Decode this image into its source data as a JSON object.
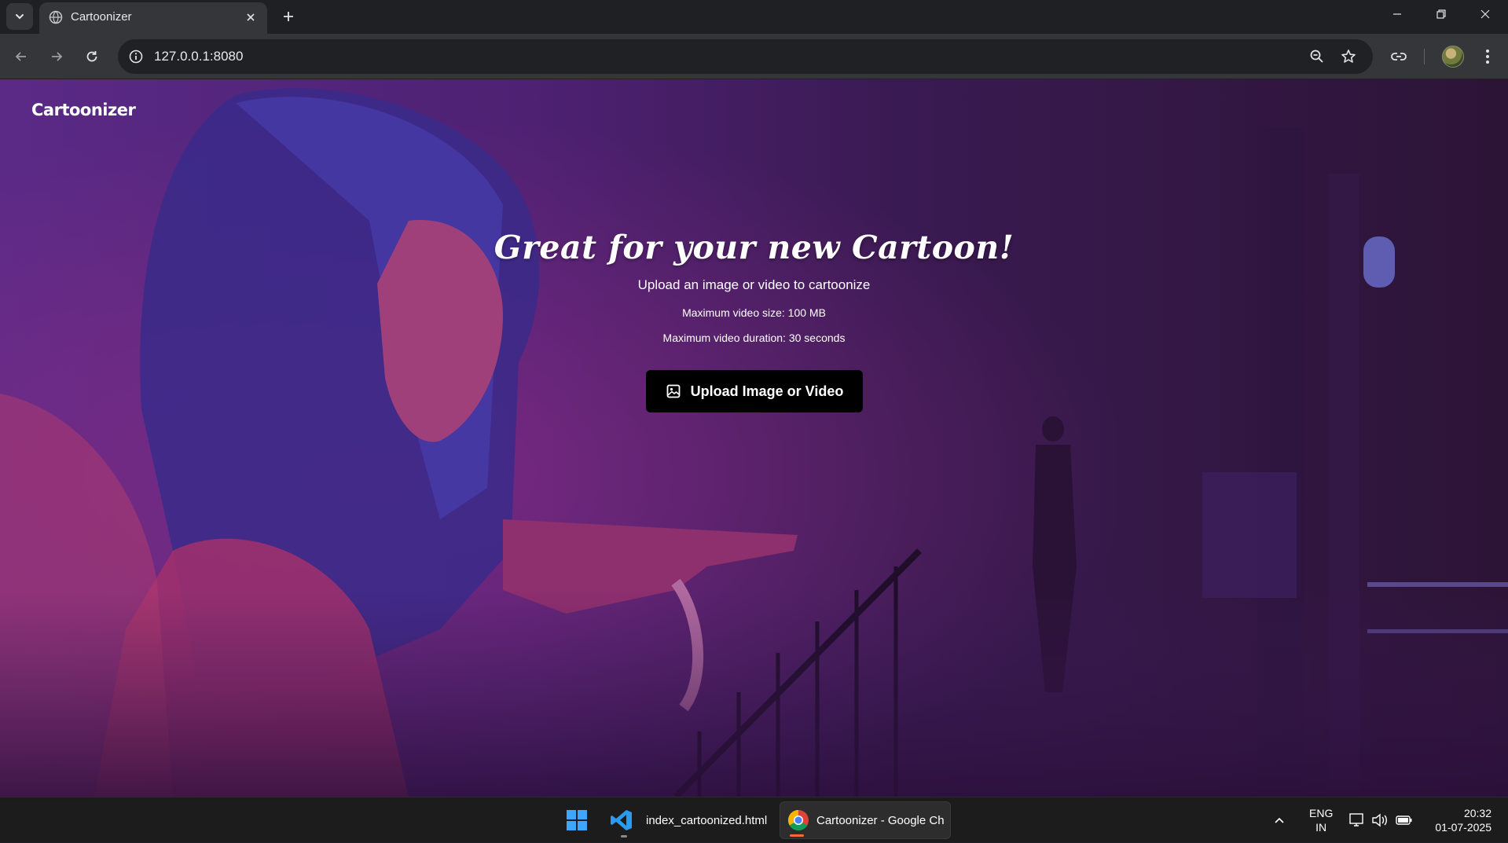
{
  "browser": {
    "tab_title": "Cartoonizer",
    "url": "127.0.0.1:8080"
  },
  "page": {
    "brand": "Cartoonizer",
    "headline": "Great for your new Cartoon!",
    "subheadline": "Upload an image or video to cartoonize",
    "max_size_note": "Maximum video size: 100 MB",
    "max_duration_note": "Maximum video duration: 30 seconds",
    "upload_button_label": "Upload Image or Video"
  },
  "taskbar": {
    "apps": [
      {
        "label": "index_cartoonized.html"
      },
      {
        "label": "Cartoonizer - Google Ch"
      }
    ],
    "language_line1": "ENG",
    "language_line2": "IN",
    "time": "20:32",
    "date": "01-07-2025"
  },
  "colors": {
    "chrome_dark": "#1f2023",
    "toolbar": "#35363a",
    "button": "#000000",
    "accent_indicator": "#ff6a3c"
  }
}
